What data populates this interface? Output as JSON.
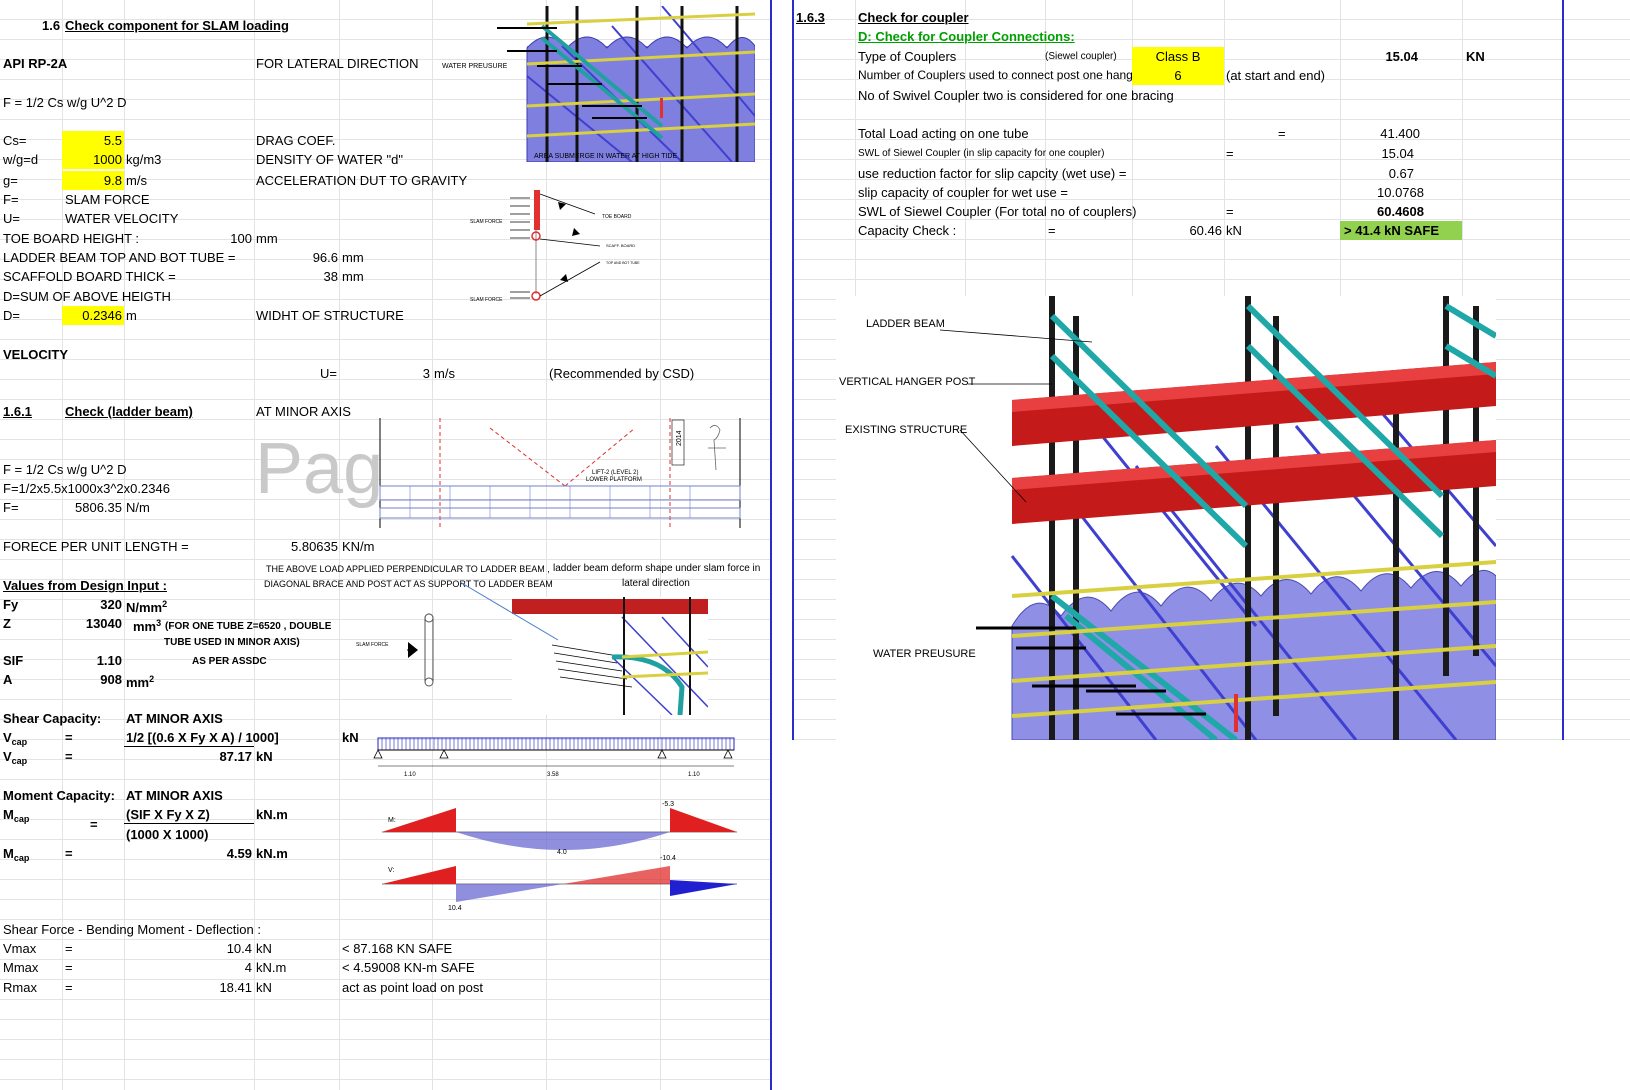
{
  "left": {
    "section_title": "1.6",
    "section_name": "Check component for SLAM loading",
    "code": "API RP-2A",
    "direction": "FOR LATERAL DIRECTION",
    "formula1": "F = 1/2 Cs w/g U^2 D",
    "params": [
      {
        "sym": "Cs=",
        "val": "5.5",
        "unit": "",
        "desc": "DRAG COEF."
      },
      {
        "sym": "w/g=d",
        "val": "1000",
        "unit": "kg/m3",
        "desc": "DENSITY OF WATER \"d\""
      },
      {
        "sym": "g=",
        "val": "9.8",
        "unit": "m/s",
        "desc": "ACCELERATION DUT TO GRAVITY"
      }
    ],
    "f_sym": "F=",
    "f_desc": "SLAM FORCE",
    "u_sym": "U=",
    "u_desc": "WATER VELOCITY",
    "toe_label": "TOE BOARD HEIGHT :",
    "toe_val": "100",
    "toe_unit": "mm",
    "ladder_label": "LADDER BEAM TOP AND BOT TUBE =",
    "ladder_val": "96.6",
    "ladder_unit": "mm",
    "board_label": "SCAFFOLD BOARD THICK =",
    "board_val": "38",
    "board_unit": "mm",
    "d_sum": "D=SUM OF ABOVE HEIGTH",
    "d_sym": "D=",
    "d_val": "0.2346",
    "d_unit": "m",
    "d_desc": "WIDHT OF STRUCTURE",
    "velocity": "VELOCITY",
    "vel_sym": "U=",
    "vel_val": "3",
    "vel_unit": "m/s",
    "vel_note": "(Recommended by CSD)",
    "sub1_num": "1.6.1",
    "sub1_name": "Check (ladder beam)",
    "sub1_axis": "AT MINOR AXIS",
    "formula2": "F = 1/2 Cs w/g U^2 D",
    "formula3": "F=1/2x5.5x1000x3^2x0.2346",
    "f_res_sym": "F=",
    "f_res_val": "5806.35",
    "f_res_unit": "N/m",
    "force_label": "FORECE PER UNIT LENGTH =",
    "force_val": "5.80635",
    "force_unit": "KN/m",
    "note_load": "THE ABOVE LOAD APPLIED PERPENDICULAR TO LADDER BEAM ,",
    "note_load2": "DIAGONAL BRACE AND POST ACT AS SUPPORT TO LADDER BEAM",
    "note_deform": "ladder beam deform shape under slam force in",
    "note_deform2": "lateral direction",
    "design_input": "Values from Design Input :",
    "fy_sym": "Fy",
    "fy_val": "320",
    "fy_unit": "N/mm",
    "z_sym": "Z",
    "z_val": "13040",
    "z_unit": "mm",
    "z_note": "(FOR ONE TUBE Z=6520 , DOUBLE",
    "z_note2": "TUBE USED IN MINOR AXIS)",
    "sif_sym": "SIF",
    "sif_val": "1.10",
    "sif_note": "AS PER ASSDC",
    "a_sym": "A",
    "a_val": "908",
    "a_unit": "mm",
    "shear_title": "Shear Capacity:",
    "shear_axis": "AT MINOR AXIS",
    "vcap_eq": "=",
    "vcap_formula": "1/2 [(0.6 X Fy X A) / 1000]",
    "vcap_kn": "kN",
    "vcap_val": "87.17",
    "vcap_unit": "kN",
    "moment_title": "Moment Capacity:",
    "moment_axis": "AT MINOR AXIS",
    "mcap_num": "(SIF X Fy X Z)",
    "mcap_unit1": "kN.m",
    "mcap_den": "(1000 X 1000)",
    "mcap_val": "4.59",
    "mcap_unit": "kN.m",
    "sfbm_title": "Shear Force - Bending Moment - Deflection :",
    "results": [
      {
        "sym": "Vmax",
        "eq": "=",
        "val": "10.4",
        "unit": "kN",
        "note": "< 87.168 KN SAFE"
      },
      {
        "sym": "Mmax",
        "eq": "=",
        "val": "4",
        "unit": "kN.m",
        "note": "< 4.59008 KN-m SAFE"
      },
      {
        "sym": "Rmax",
        "eq": "=",
        "val": "18.41",
        "unit": "kN",
        "note": "act as point load on post"
      }
    ],
    "watermark": "Pag",
    "fig_water": "WATER PREUSURE",
    "fig_submerge": "AREA SUBMERGE IN WATER AT HIGH TIDE",
    "fig_slam1": "SLAM FORCE",
    "fig_slam2": "SLAM FORCE",
    "fig_toe": "TOE BOARD",
    "fig_scaff": "SCAFF. BOARD",
    "fig_tube": "TOP AND BOT TUBE",
    "fig_lift1": "LIFT-2 (LEVEL 2)",
    "fig_lift2": "LOWER PLATFORM",
    "fig_year": "2014",
    "fig_slam3": "SLAM FORCE",
    "beam_dims": [
      "1.10",
      "3.58",
      "1.10"
    ],
    "moment_labels": {
      "m": "M:",
      "neg": "-5.3",
      "pos": "4.0"
    },
    "shear_labels": {
      "v": "V:",
      "neg": "-10.4",
      "pos": "10.4"
    }
  },
  "right": {
    "sub_num": "1.6.3",
    "sub_name": "Check for coupler",
    "d_title": "D: Check for Coupler Connections:",
    "type_label": "Type of Couplers",
    "type_sub": "(Siewel coupler)",
    "type_class": "Class B",
    "type_val": "15.04",
    "type_unit": "KN",
    "num_label": "Number of Couplers used to connect post one hange",
    "num_val": "6",
    "num_note": "(at start and end)",
    "swivel_note": "No of Swivel Coupler two is considered for one bracing",
    "total_label": "Total Load acting on one  tube",
    "total_eq": "=",
    "total_val": "41.400",
    "swl_label": "SWL of Siewel Coupler  (in slip capacity for one coupler)",
    "swl_eq": "=",
    "swl_val": "15.04",
    "red_label": "use reduction factor for slip capcity (wet use) =",
    "red_val": "0.67",
    "slip_label": "slip capacity of coupler for wet use =",
    "slip_val": "10.0768",
    "swlt_label": "SWL of Siewel Coupler   (For total no of couplers)",
    "swlt_eq": "=",
    "swlt_val": "60.4608",
    "cap_label": "Capacity Check :",
    "cap_eq": "=",
    "cap_val": "60.46",
    "cap_unit": "kN",
    "cap_result": ">  41.4 kN  SAFE",
    "fig_labels": {
      "ladder": "LADDER BEAM",
      "hanger": "VERTICAL HANGER POST",
      "existing": "EXISTING STRUCTURE",
      "water": "WATER PREUSURE"
    }
  }
}
